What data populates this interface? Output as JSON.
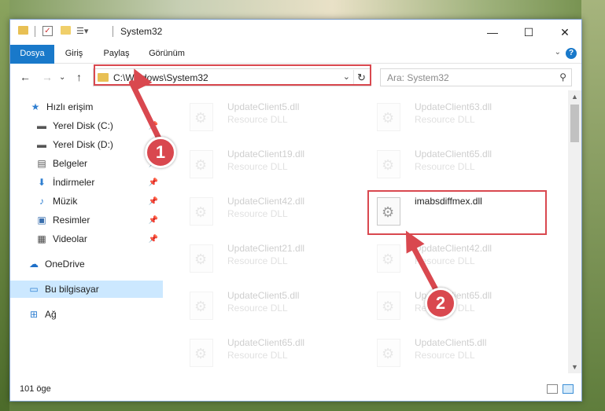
{
  "window": {
    "title": "System32",
    "controls": {
      "minimize": "—",
      "maximize": "☐",
      "close": "✕"
    }
  },
  "ribbon": {
    "tabs": [
      "Dosya",
      "Giriş",
      "Paylaş",
      "Görünüm"
    ],
    "help": "?"
  },
  "address": {
    "path": "C:\\Windows\\System32",
    "search_placeholder": "Ara: System32"
  },
  "nav": {
    "items": [
      {
        "label": "Hızlı erişim",
        "icon": "star-icon"
      },
      {
        "label": "Yerel Disk (C:)",
        "icon": "drive-icon",
        "pinned": true
      },
      {
        "label": "Yerel Disk (D:)",
        "icon": "drive-icon"
      },
      {
        "label": "Belgeler",
        "icon": "document-icon",
        "pinned": true
      },
      {
        "label": "İndirmeler",
        "icon": "download-icon",
        "pinned": true
      },
      {
        "label": "Müzik",
        "icon": "music-icon",
        "pinned": true
      },
      {
        "label": "Resimler",
        "icon": "picture-icon",
        "pinned": true
      },
      {
        "label": "Videolar",
        "icon": "video-icon",
        "pinned": true
      },
      {
        "label": "OneDrive",
        "icon": "cloud-icon"
      },
      {
        "label": "Bu bilgisayar",
        "icon": "computer-icon",
        "selected": true
      },
      {
        "label": "Ağ",
        "icon": "network-icon"
      }
    ]
  },
  "files": {
    "left": [
      {
        "name": "UpdateClient5.dll",
        "type": "Resource DLL"
      },
      {
        "name": "UpdateClient19.dll",
        "type": "Resource DLL"
      },
      {
        "name": "UpdateClient42.dll",
        "type": "Resource DLL"
      },
      {
        "name": "UpdateClient21.dll",
        "type": "Resource DLL"
      },
      {
        "name": "UpdateClient5.dll",
        "type": "Resource DLL"
      },
      {
        "name": "UpdateClient65.dll",
        "type": "Resource DLL"
      }
    ],
    "right": [
      {
        "name": "UpdateClient63.dll",
        "type": "Resource DLL"
      },
      {
        "name": "UpdateClient65.dll",
        "type": "Resource DLL"
      },
      {
        "name": "imabsdiffmex.dll",
        "type": "",
        "highlighted": true
      },
      {
        "name": "UpdateClient42.dll",
        "type": "Resource DLL"
      },
      {
        "name": "UpdateClient65.dll",
        "type": "Resource DLL"
      },
      {
        "name": "UpdateClient5.dll",
        "type": "Resource DLL"
      }
    ]
  },
  "status": {
    "count": "101 öge"
  },
  "annotations": {
    "step1": "1",
    "step2": "2",
    "color": "#d9484f"
  }
}
